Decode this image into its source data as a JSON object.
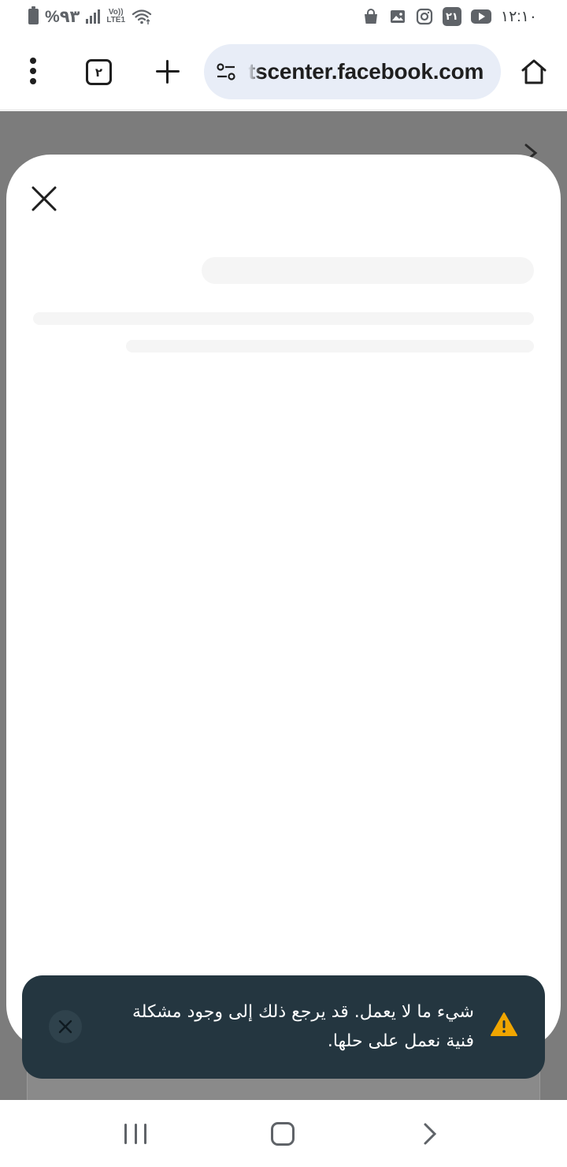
{
  "status_bar": {
    "battery_percent": "%٩٣",
    "network_label": "LTE1",
    "volte_label": "Vo))",
    "notification_badge": "٢١",
    "time": "١٢:١٠",
    "icons": [
      "battery-icon",
      "signal-icon",
      "wifi-icon",
      "shopping-bag-icon",
      "gallery-icon",
      "instagram-icon",
      "youtube-icon"
    ]
  },
  "browser": {
    "tab_count": "٢",
    "url": "tscenter.facebook.com",
    "icons": [
      "more-options-icon",
      "tabs-icon",
      "plus-icon",
      "site-settings-icon",
      "home-icon"
    ]
  },
  "dialog": {
    "loading": true,
    "icons": [
      "close-icon"
    ]
  },
  "snackbar": {
    "message": "شيء ما لا يعمل. قد يرجع ذلك إلى وجود مشكلة فنية نعمل على حلها.",
    "icons": [
      "warning-icon",
      "close-icon"
    ],
    "colors": {
      "background": "#243640",
      "warning": "#f0a500"
    }
  },
  "nav_bar": {
    "icons": [
      "recents-icon",
      "home-outline-icon",
      "back-chevron-icon"
    ]
  }
}
